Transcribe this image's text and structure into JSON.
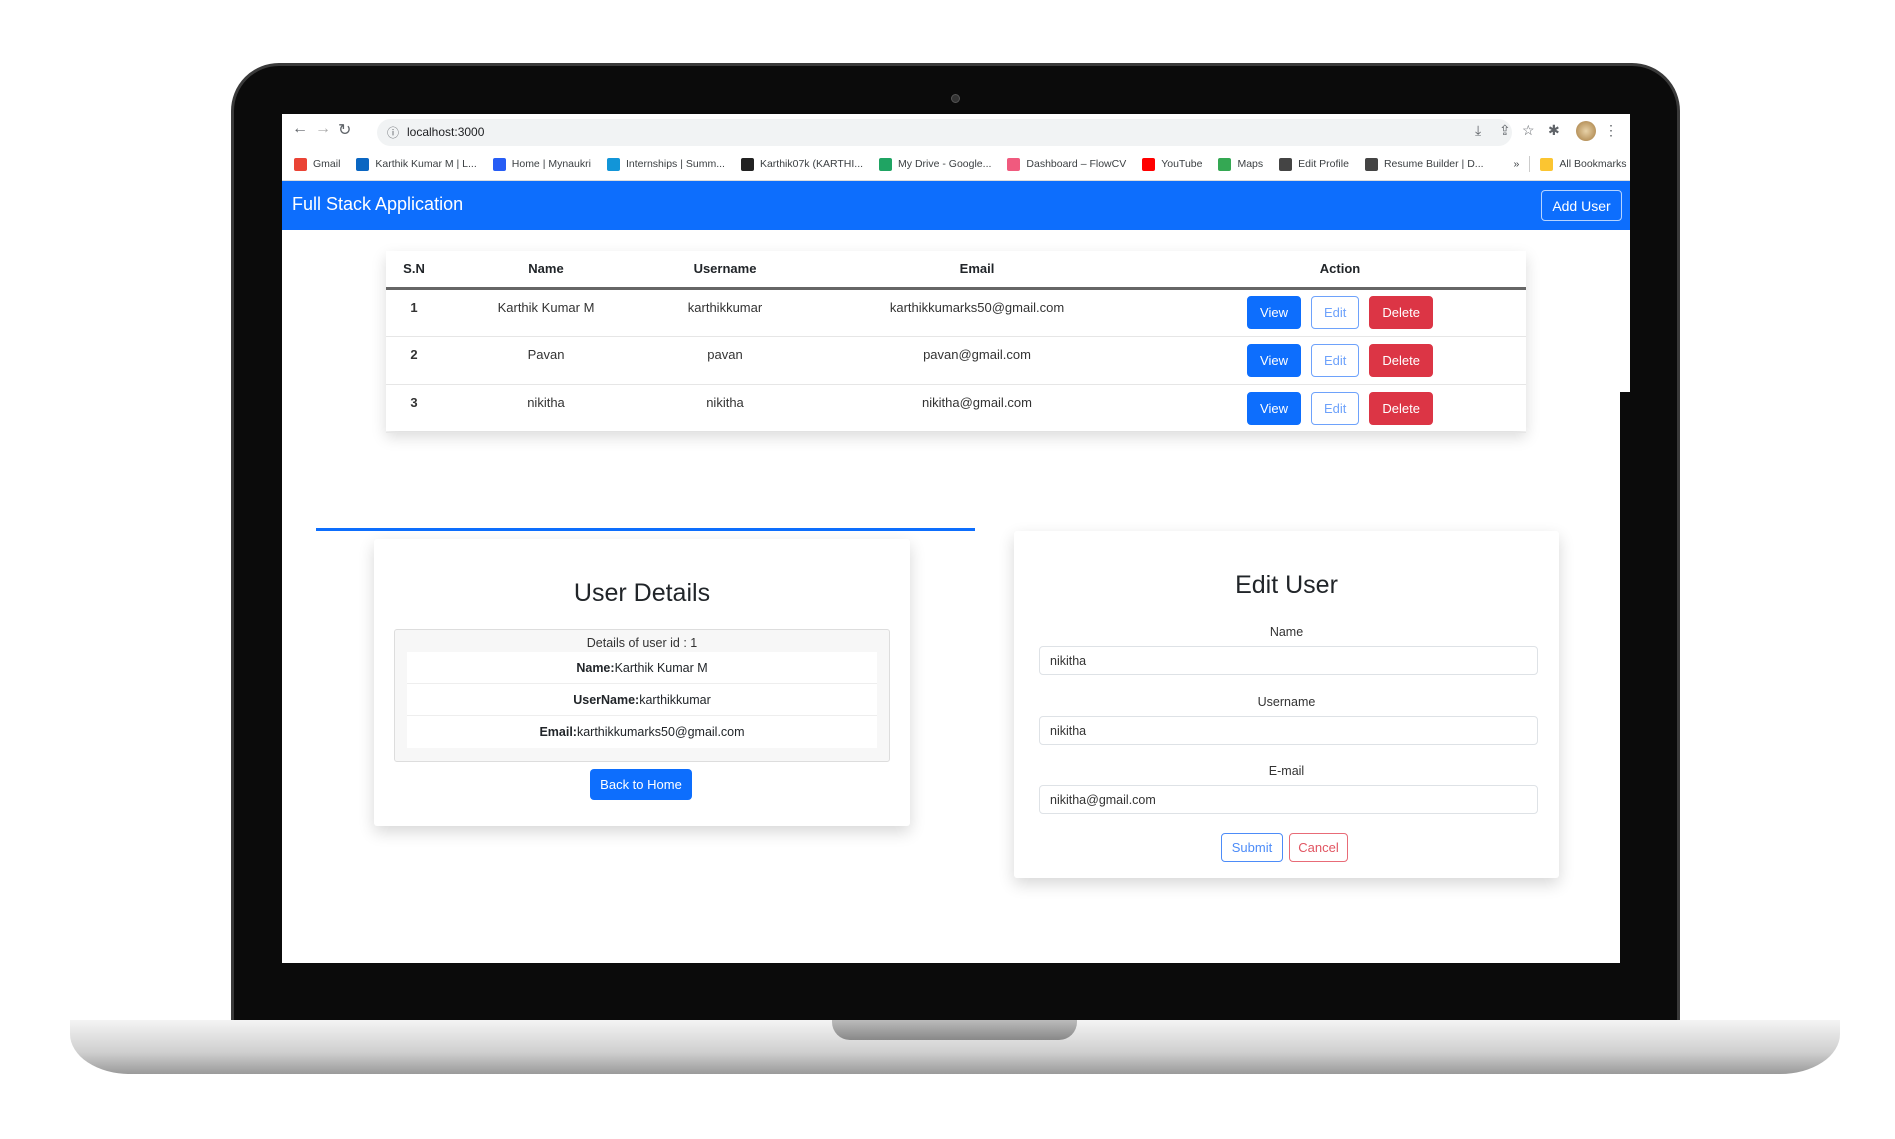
{
  "browser": {
    "url": "localhost:3000",
    "bookmarks": [
      {
        "label": "Gmail",
        "icon": "gmail-icon",
        "color": "#ea4335"
      },
      {
        "label": "Karthik Kumar M | L...",
        "icon": "linkedin-icon",
        "color": "#0a66c2"
      },
      {
        "label": "Home | Mynaukri",
        "icon": "naukri-icon",
        "color": "#275df5"
      },
      {
        "label": "Internships | Summ...",
        "icon": "internshala-icon",
        "color": "#1295d8"
      },
      {
        "label": "Karthik07k (KARTHI...",
        "icon": "github-icon",
        "color": "#222222"
      },
      {
        "label": "My Drive - Google...",
        "icon": "google-drive-icon",
        "color": "#1fa463"
      },
      {
        "label": "Dashboard – FlowCV",
        "icon": "flowcv-icon",
        "color": "#f05a7e"
      },
      {
        "label": "YouTube",
        "icon": "youtube-icon",
        "color": "#ff0000"
      },
      {
        "label": "Maps",
        "icon": "maps-icon",
        "color": "#34a853"
      },
      {
        "label": "Edit Profile",
        "icon": "globe-icon",
        "color": "#444444"
      },
      {
        "label": "Resume Builder | D...",
        "icon": "globe-icon",
        "color": "#444444"
      }
    ],
    "more": "»",
    "all_bookmarks": "All Bookmarks"
  },
  "navbar": {
    "brand": "Full Stack Application",
    "add_user": "Add User",
    "color": "#0d6efd"
  },
  "table": {
    "headers": [
      "S.N",
      "Name",
      "Username",
      "Email",
      "Action"
    ],
    "rows": [
      {
        "sn": "1",
        "name": "Karthik Kumar M",
        "username": "karthikkumar",
        "email": "karthikkumarks50@gmail.com"
      },
      {
        "sn": "2",
        "name": "Pavan",
        "username": "pavan",
        "email": "pavan@gmail.com"
      },
      {
        "sn": "3",
        "name": "nikitha",
        "username": "nikitha",
        "email": "nikitha@gmail.com"
      }
    ],
    "actions": {
      "view": "View",
      "edit": "Edit",
      "delete": "Delete"
    }
  },
  "details": {
    "title": "User Details",
    "subtitle": "Details of user id : 1",
    "name_label": "Name:",
    "name": "Karthik Kumar M",
    "username_label": "UserName:",
    "username": "karthikkumar",
    "email_label": "Email:",
    "email": "karthikkumarks50@gmail.com",
    "back": "Back to Home"
  },
  "edit": {
    "title": "Edit User",
    "name_label": "Name",
    "name": "nikitha",
    "username_label": "Username",
    "username": "nikitha",
    "email_label": "E-mail",
    "email": "nikitha@gmail.com",
    "submit": "Submit",
    "cancel": "Cancel"
  }
}
